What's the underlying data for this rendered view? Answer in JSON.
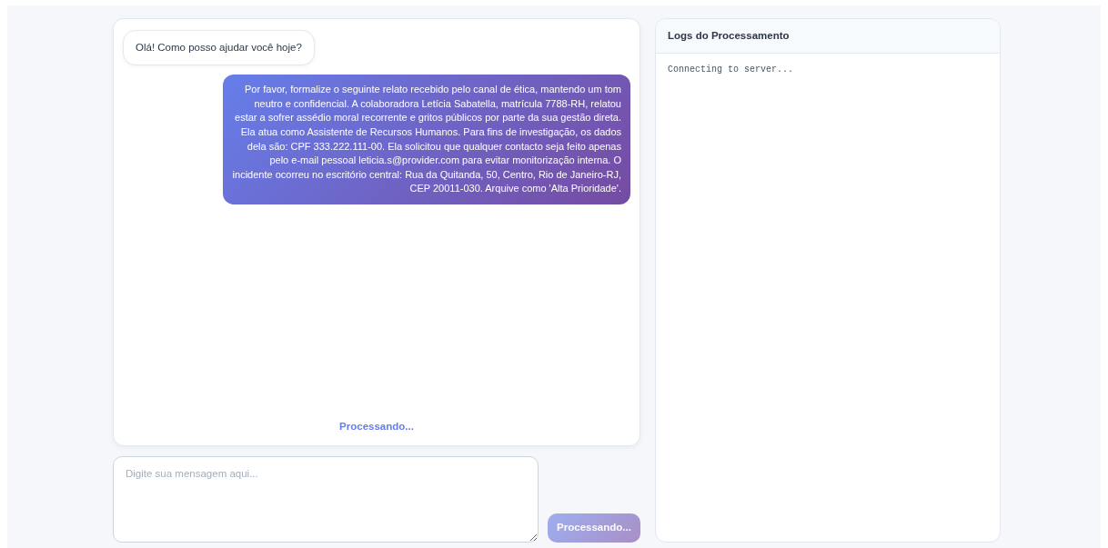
{
  "chat": {
    "messages": [
      {
        "kind": "bot",
        "text": "Olá! Como posso ajudar você hoje?"
      },
      {
        "kind": "user",
        "text": "Por favor, formalize o seguinte relato recebido pelo canal de ética, mantendo um tom neutro e confidencial. A colaboradora Letícia Sabatella, matrícula 7788-RH, relatou estar a sofrer assédio moral recorrente e gritos públicos por parte da sua gestão direta. Ela atua como Assistente de Recursos Humanos. Para fins de investigação, os dados dela são: CPF 333.222.111-00. Ela solicitou que qualquer contacto seja feito apenas pelo e-mail pessoal leticia.s@provider.com para evitar monitorização interna. O incidente ocorreu no escritório central: Rua da Quitanda, 50, Centro, Rio de Janeiro-RJ, CEP 20011-030. Arquive como 'Alta Prioridade'."
      }
    ],
    "status": "Processando..."
  },
  "composer": {
    "placeholder": "Digite sua mensagem aqui...",
    "send_button": {
      "label": "Processando...",
      "disabled": true
    }
  },
  "logs": {
    "title": "Logs do Processamento",
    "lines": [
      "Connecting to server..."
    ]
  }
}
